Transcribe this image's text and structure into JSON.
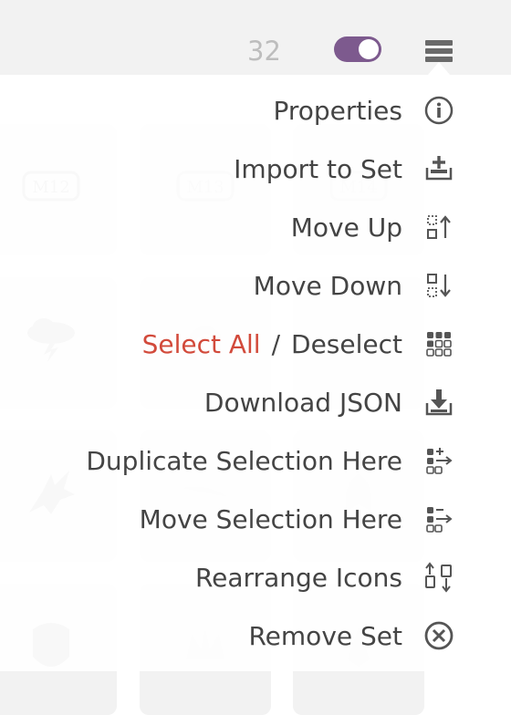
{
  "header": {
    "count": "32",
    "toggle_on": true,
    "accent_color": "#7d5a8e",
    "menu_icon": "hamburger-icon"
  },
  "tiles": [
    {
      "icon": "m12-set-icon",
      "label": "M12"
    },
    {
      "icon": "m13-set-icon",
      "label": "M13"
    },
    {
      "icon": "m14-set-icon",
      "label": "M14"
    },
    {
      "icon": "storm-cloud-set-icon"
    },
    {
      "icon": "arch-set-icon"
    },
    {
      "icon": "claw-set-icon"
    },
    {
      "icon": "dragon-head-set-icon"
    },
    {
      "icon": "blade-set-icon"
    },
    {
      "icon": "ribcage-set-icon"
    },
    {
      "icon": "shield-set-icon"
    },
    {
      "icon": "crown-set-icon"
    },
    {
      "icon": "spire-set-icon"
    }
  ],
  "menu": {
    "properties": "Properties",
    "import_to_set": "Import to Set",
    "move_up": "Move Up",
    "move_down": "Move Down",
    "select_all": "Select All",
    "select_sep": "/",
    "deselect": "Deselect",
    "download_json": "Download JSON",
    "duplicate_selection": "Duplicate Selection Here",
    "move_selection": "Move Selection Here",
    "rearrange_icons": "Rearrange Icons",
    "remove_set": "Remove Set",
    "colors": {
      "text": "#444444",
      "accent": "#d24a3b",
      "icon": "#555555"
    }
  }
}
